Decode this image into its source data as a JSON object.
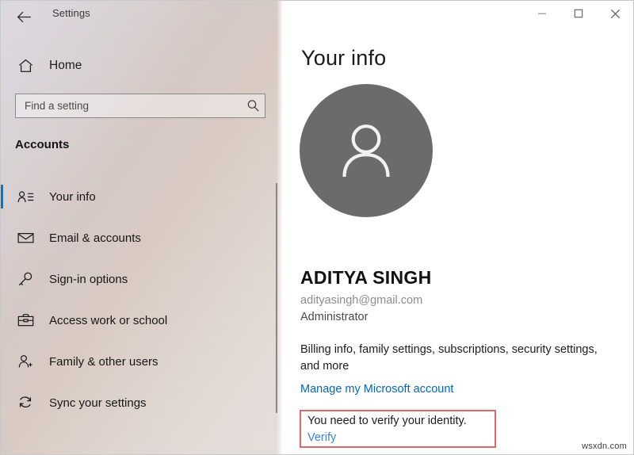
{
  "window": {
    "title": "Settings",
    "back_icon": "back-arrow-icon",
    "controls": {
      "minimize": "minimize-icon",
      "maximize": "maximize-icon",
      "close": "close-icon"
    }
  },
  "sidebar": {
    "home": {
      "label": "Home",
      "icon": "home-icon"
    },
    "search": {
      "placeholder": "Find a setting",
      "value": "",
      "icon": "search-icon"
    },
    "section_header": "Accounts",
    "items": [
      {
        "label": "Your info",
        "icon": "person-card-icon",
        "selected": true
      },
      {
        "label": "Email & accounts",
        "icon": "envelope-icon",
        "selected": false
      },
      {
        "label": "Sign-in options",
        "icon": "key-icon",
        "selected": false
      },
      {
        "label": "Access work or school",
        "icon": "briefcase-icon",
        "selected": false
      },
      {
        "label": "Family & other users",
        "icon": "person-add-icon",
        "selected": false
      },
      {
        "label": "Sync your settings",
        "icon": "sync-icon",
        "selected": false
      }
    ],
    "accent_color": "#0078d7"
  },
  "main": {
    "page_title": "Your info",
    "avatar_icon": "user-avatar-icon",
    "user_name": "ADITYA SINGH",
    "user_email": "adityasingh@gmail.com",
    "user_role": "Administrator",
    "billing_text": "Billing info, family settings, subscriptions, security settings, and more",
    "manage_link": "Manage my Microsoft account",
    "verify": {
      "message": "You need to verify your identity.",
      "link": "Verify",
      "border_color": "#e06a6a"
    }
  },
  "watermark": "wsxdn.com"
}
